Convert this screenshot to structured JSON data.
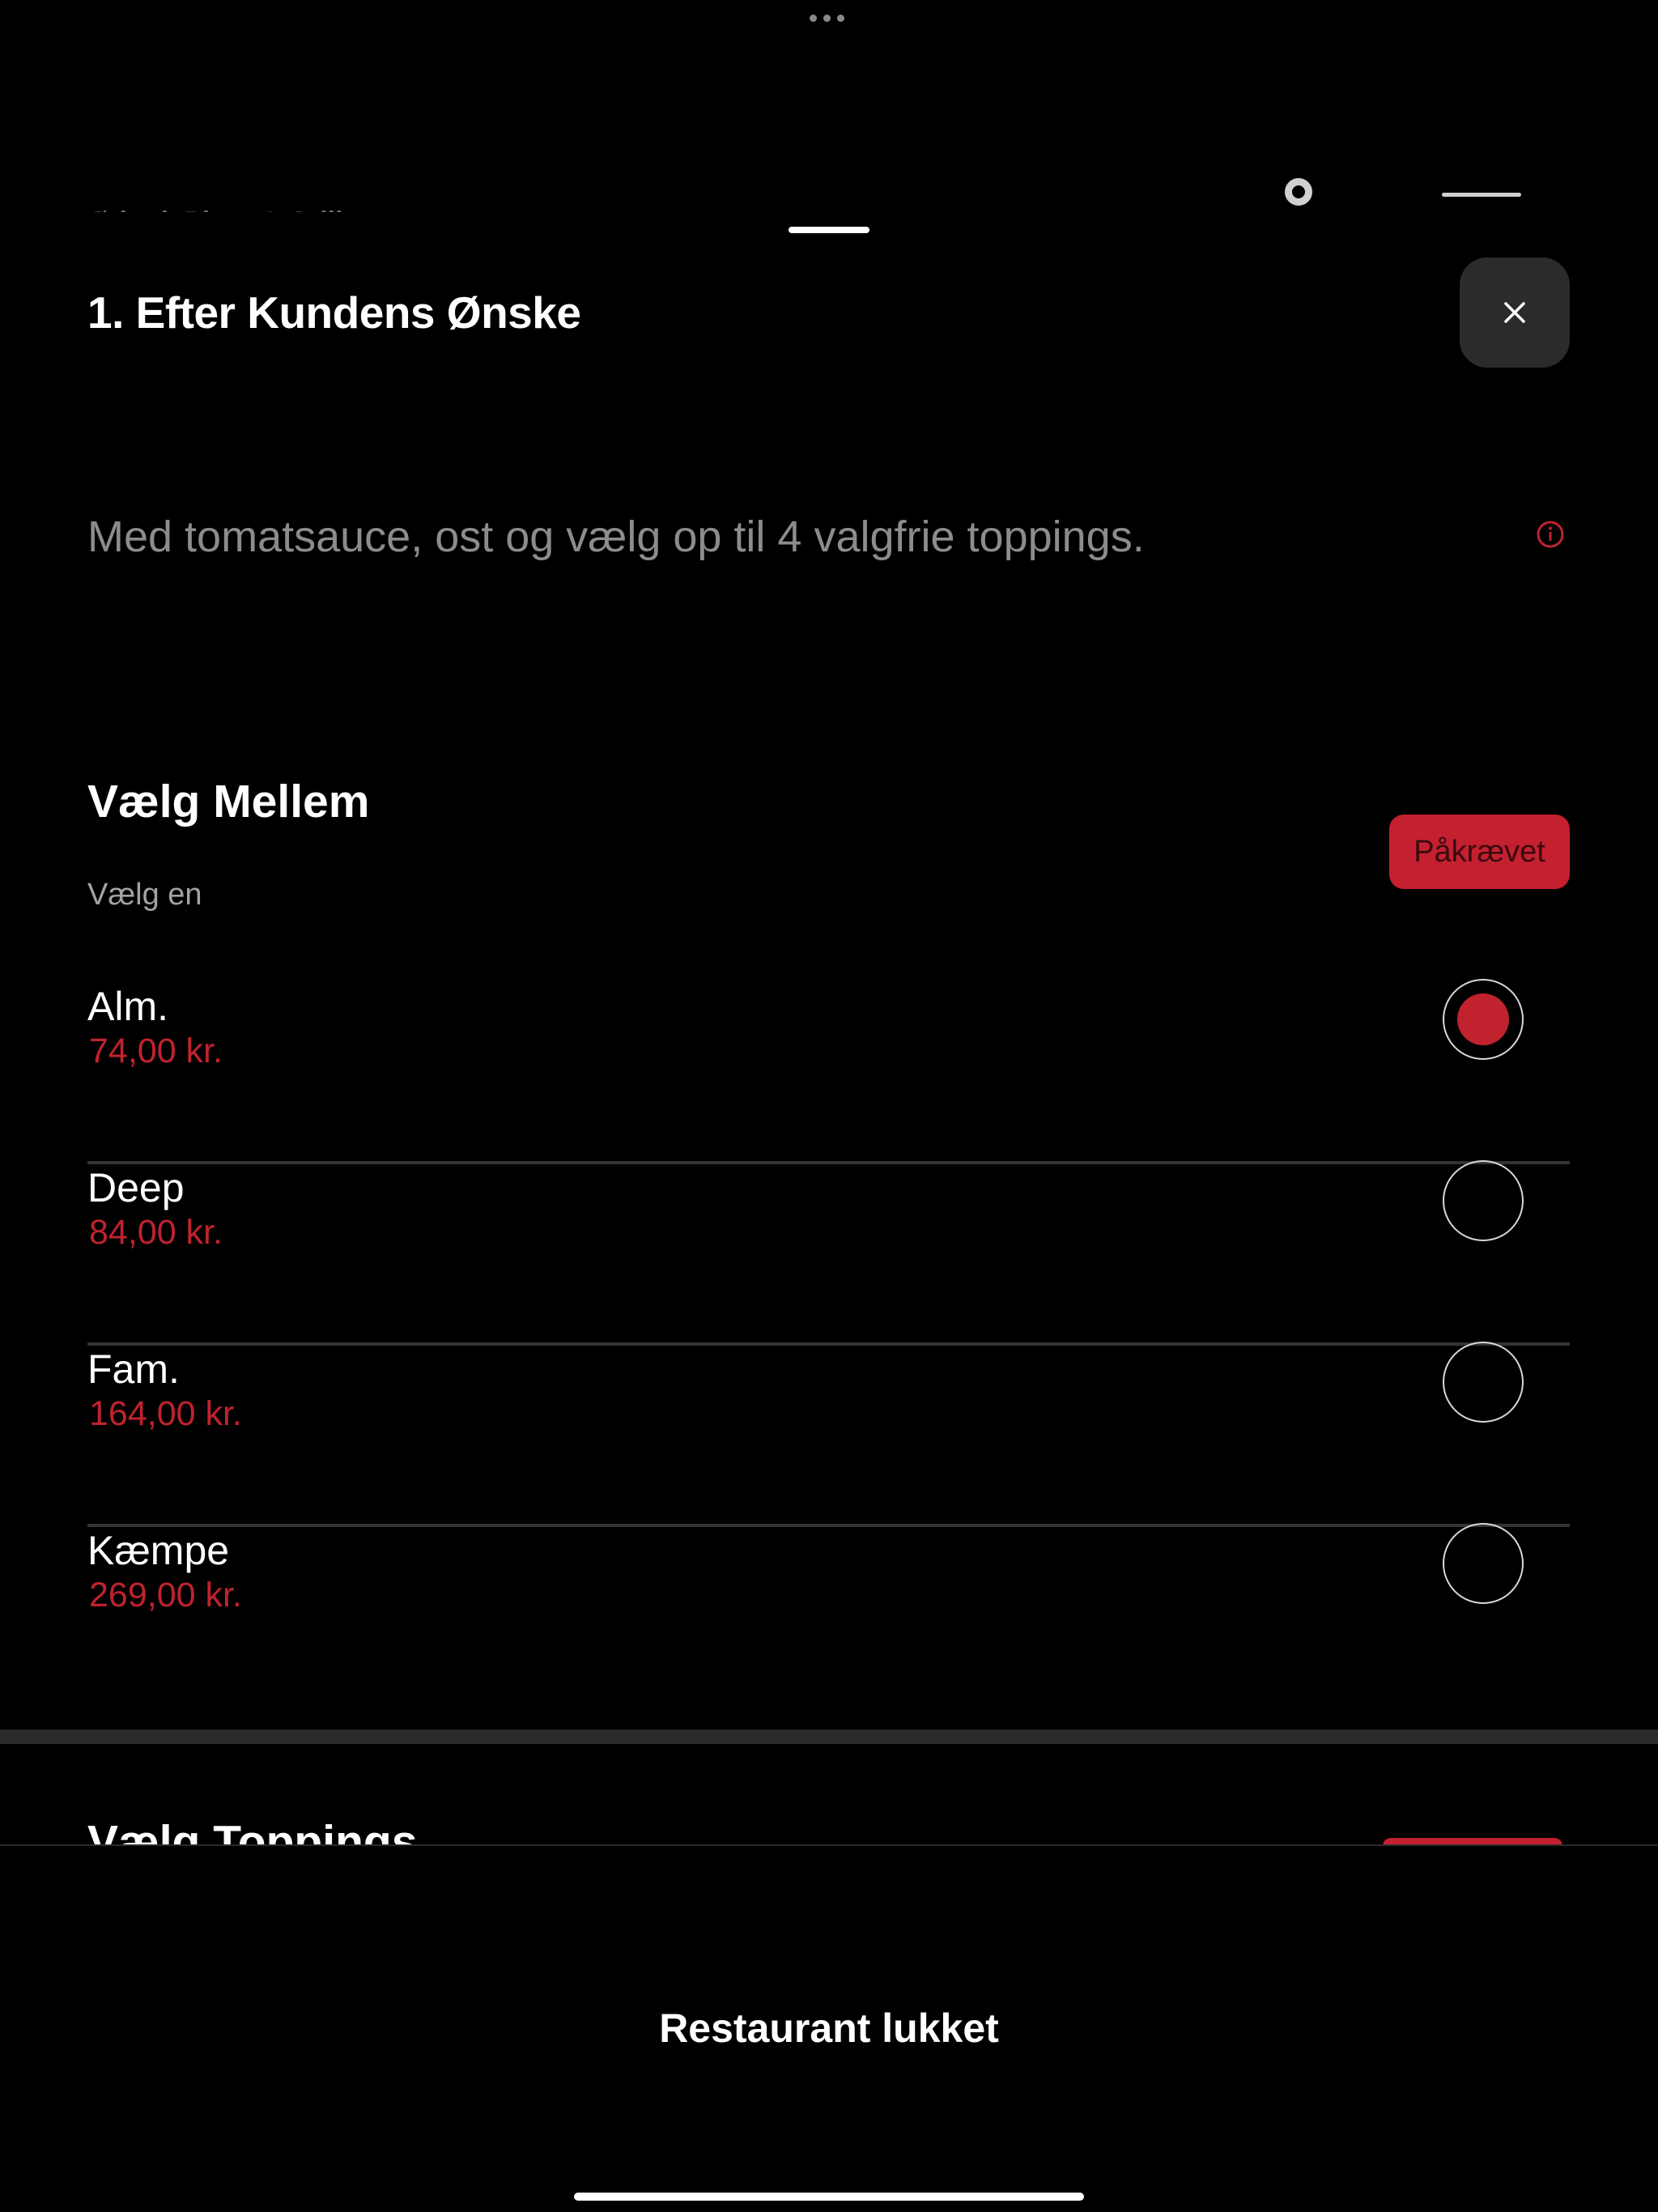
{
  "background": {
    "restaurant_name": "Ørbæk Pizza & Grill"
  },
  "sheet": {
    "title": "1. Efter Kundens Ønske",
    "description": "Med tomatsauce, ost og vælg op til 4 valgfrie toppings."
  },
  "size_section": {
    "title": "Vælg Mellem",
    "subtitle": "Vælg en",
    "required_label": "Påkrævet",
    "options": [
      {
        "name": "Alm.",
        "price": "74,00 kr.",
        "selected": true
      },
      {
        "name": "Deep",
        "price": "84,00 kr.",
        "selected": false
      },
      {
        "name": "Fam.",
        "price": "164,00 kr.",
        "selected": false
      },
      {
        "name": "Kæmpe",
        "price": "269,00 kr.",
        "selected": false
      }
    ]
  },
  "toppings_section": {
    "title": "Vælg Toppings"
  },
  "footer": {
    "status_label": "Restaurant lukket"
  },
  "colors": {
    "accent": "#c0222e",
    "background": "#000000",
    "divider": "#333333"
  },
  "icons": {
    "close": "close-icon",
    "info": "info-icon"
  }
}
